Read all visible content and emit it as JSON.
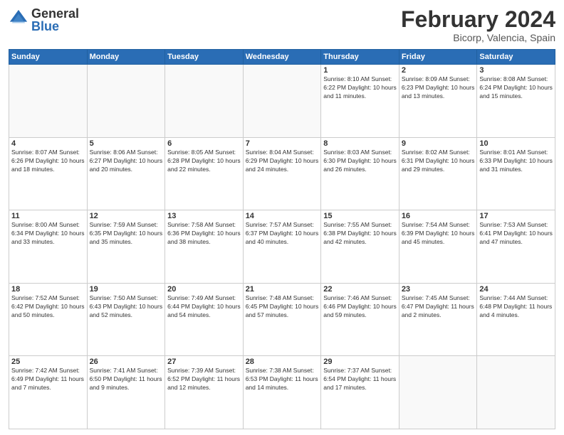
{
  "header": {
    "logo": {
      "general": "General",
      "blue": "Blue"
    },
    "title": "February 2024",
    "subtitle": "Bicorp, Valencia, Spain"
  },
  "weekdays": [
    "Sunday",
    "Monday",
    "Tuesday",
    "Wednesday",
    "Thursday",
    "Friday",
    "Saturday"
  ],
  "weeks": [
    [
      {
        "day": "",
        "info": "",
        "empty": true
      },
      {
        "day": "",
        "info": "",
        "empty": true
      },
      {
        "day": "",
        "info": "",
        "empty": true
      },
      {
        "day": "",
        "info": "",
        "empty": true
      },
      {
        "day": "1",
        "info": "Sunrise: 8:10 AM\nSunset: 6:22 PM\nDaylight: 10 hours\nand 11 minutes.",
        "empty": false
      },
      {
        "day": "2",
        "info": "Sunrise: 8:09 AM\nSunset: 6:23 PM\nDaylight: 10 hours\nand 13 minutes.",
        "empty": false
      },
      {
        "day": "3",
        "info": "Sunrise: 8:08 AM\nSunset: 6:24 PM\nDaylight: 10 hours\nand 15 minutes.",
        "empty": false
      }
    ],
    [
      {
        "day": "4",
        "info": "Sunrise: 8:07 AM\nSunset: 6:26 PM\nDaylight: 10 hours\nand 18 minutes.",
        "empty": false
      },
      {
        "day": "5",
        "info": "Sunrise: 8:06 AM\nSunset: 6:27 PM\nDaylight: 10 hours\nand 20 minutes.",
        "empty": false
      },
      {
        "day": "6",
        "info": "Sunrise: 8:05 AM\nSunset: 6:28 PM\nDaylight: 10 hours\nand 22 minutes.",
        "empty": false
      },
      {
        "day": "7",
        "info": "Sunrise: 8:04 AM\nSunset: 6:29 PM\nDaylight: 10 hours\nand 24 minutes.",
        "empty": false
      },
      {
        "day": "8",
        "info": "Sunrise: 8:03 AM\nSunset: 6:30 PM\nDaylight: 10 hours\nand 26 minutes.",
        "empty": false
      },
      {
        "day": "9",
        "info": "Sunrise: 8:02 AM\nSunset: 6:31 PM\nDaylight: 10 hours\nand 29 minutes.",
        "empty": false
      },
      {
        "day": "10",
        "info": "Sunrise: 8:01 AM\nSunset: 6:33 PM\nDaylight: 10 hours\nand 31 minutes.",
        "empty": false
      }
    ],
    [
      {
        "day": "11",
        "info": "Sunrise: 8:00 AM\nSunset: 6:34 PM\nDaylight: 10 hours\nand 33 minutes.",
        "empty": false
      },
      {
        "day": "12",
        "info": "Sunrise: 7:59 AM\nSunset: 6:35 PM\nDaylight: 10 hours\nand 35 minutes.",
        "empty": false
      },
      {
        "day": "13",
        "info": "Sunrise: 7:58 AM\nSunset: 6:36 PM\nDaylight: 10 hours\nand 38 minutes.",
        "empty": false
      },
      {
        "day": "14",
        "info": "Sunrise: 7:57 AM\nSunset: 6:37 PM\nDaylight: 10 hours\nand 40 minutes.",
        "empty": false
      },
      {
        "day": "15",
        "info": "Sunrise: 7:55 AM\nSunset: 6:38 PM\nDaylight: 10 hours\nand 42 minutes.",
        "empty": false
      },
      {
        "day": "16",
        "info": "Sunrise: 7:54 AM\nSunset: 6:39 PM\nDaylight: 10 hours\nand 45 minutes.",
        "empty": false
      },
      {
        "day": "17",
        "info": "Sunrise: 7:53 AM\nSunset: 6:41 PM\nDaylight: 10 hours\nand 47 minutes.",
        "empty": false
      }
    ],
    [
      {
        "day": "18",
        "info": "Sunrise: 7:52 AM\nSunset: 6:42 PM\nDaylight: 10 hours\nand 50 minutes.",
        "empty": false
      },
      {
        "day": "19",
        "info": "Sunrise: 7:50 AM\nSunset: 6:43 PM\nDaylight: 10 hours\nand 52 minutes.",
        "empty": false
      },
      {
        "day": "20",
        "info": "Sunrise: 7:49 AM\nSunset: 6:44 PM\nDaylight: 10 hours\nand 54 minutes.",
        "empty": false
      },
      {
        "day": "21",
        "info": "Sunrise: 7:48 AM\nSunset: 6:45 PM\nDaylight: 10 hours\nand 57 minutes.",
        "empty": false
      },
      {
        "day": "22",
        "info": "Sunrise: 7:46 AM\nSunset: 6:46 PM\nDaylight: 10 hours\nand 59 minutes.",
        "empty": false
      },
      {
        "day": "23",
        "info": "Sunrise: 7:45 AM\nSunset: 6:47 PM\nDaylight: 11 hours\nand 2 minutes.",
        "empty": false
      },
      {
        "day": "24",
        "info": "Sunrise: 7:44 AM\nSunset: 6:48 PM\nDaylight: 11 hours\nand 4 minutes.",
        "empty": false
      }
    ],
    [
      {
        "day": "25",
        "info": "Sunrise: 7:42 AM\nSunset: 6:49 PM\nDaylight: 11 hours\nand 7 minutes.",
        "empty": false
      },
      {
        "day": "26",
        "info": "Sunrise: 7:41 AM\nSunset: 6:50 PM\nDaylight: 11 hours\nand 9 minutes.",
        "empty": false
      },
      {
        "day": "27",
        "info": "Sunrise: 7:39 AM\nSunset: 6:52 PM\nDaylight: 11 hours\nand 12 minutes.",
        "empty": false
      },
      {
        "day": "28",
        "info": "Sunrise: 7:38 AM\nSunset: 6:53 PM\nDaylight: 11 hours\nand 14 minutes.",
        "empty": false
      },
      {
        "day": "29",
        "info": "Sunrise: 7:37 AM\nSunset: 6:54 PM\nDaylight: 11 hours\nand 17 minutes.",
        "empty": false
      },
      {
        "day": "",
        "info": "",
        "empty": true
      },
      {
        "day": "",
        "info": "",
        "empty": true
      }
    ]
  ]
}
